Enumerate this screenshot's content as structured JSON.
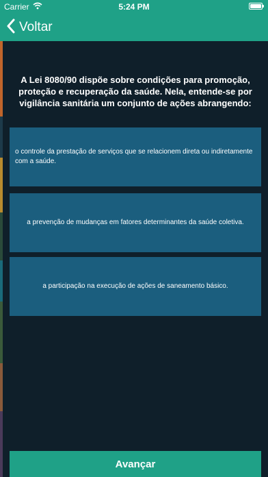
{
  "status_bar": {
    "carrier": "Carrier",
    "time": "5:24 PM",
    "battery_level": 1.0
  },
  "nav": {
    "back_label": "Voltar"
  },
  "question": "A Lei 8080/90 dispõe sobre condições para promoção, proteção e recuperação da saúde. Nela, entende-se por vigilância sanitária um conjunto de ações abrangendo:",
  "options": [
    "o controle da prestação de serviços que se relacionem direta ou indiretamente com a saúde.",
    "a prevenção de mudanças em fatores determinantes da saúde coletiva.",
    "a participação na execução de ações de saneamento básico."
  ],
  "advance_label": "Avançar",
  "colors": {
    "accent": "#1fa187",
    "background": "#0f1f2a",
    "option_background": "#1b5e7e"
  }
}
